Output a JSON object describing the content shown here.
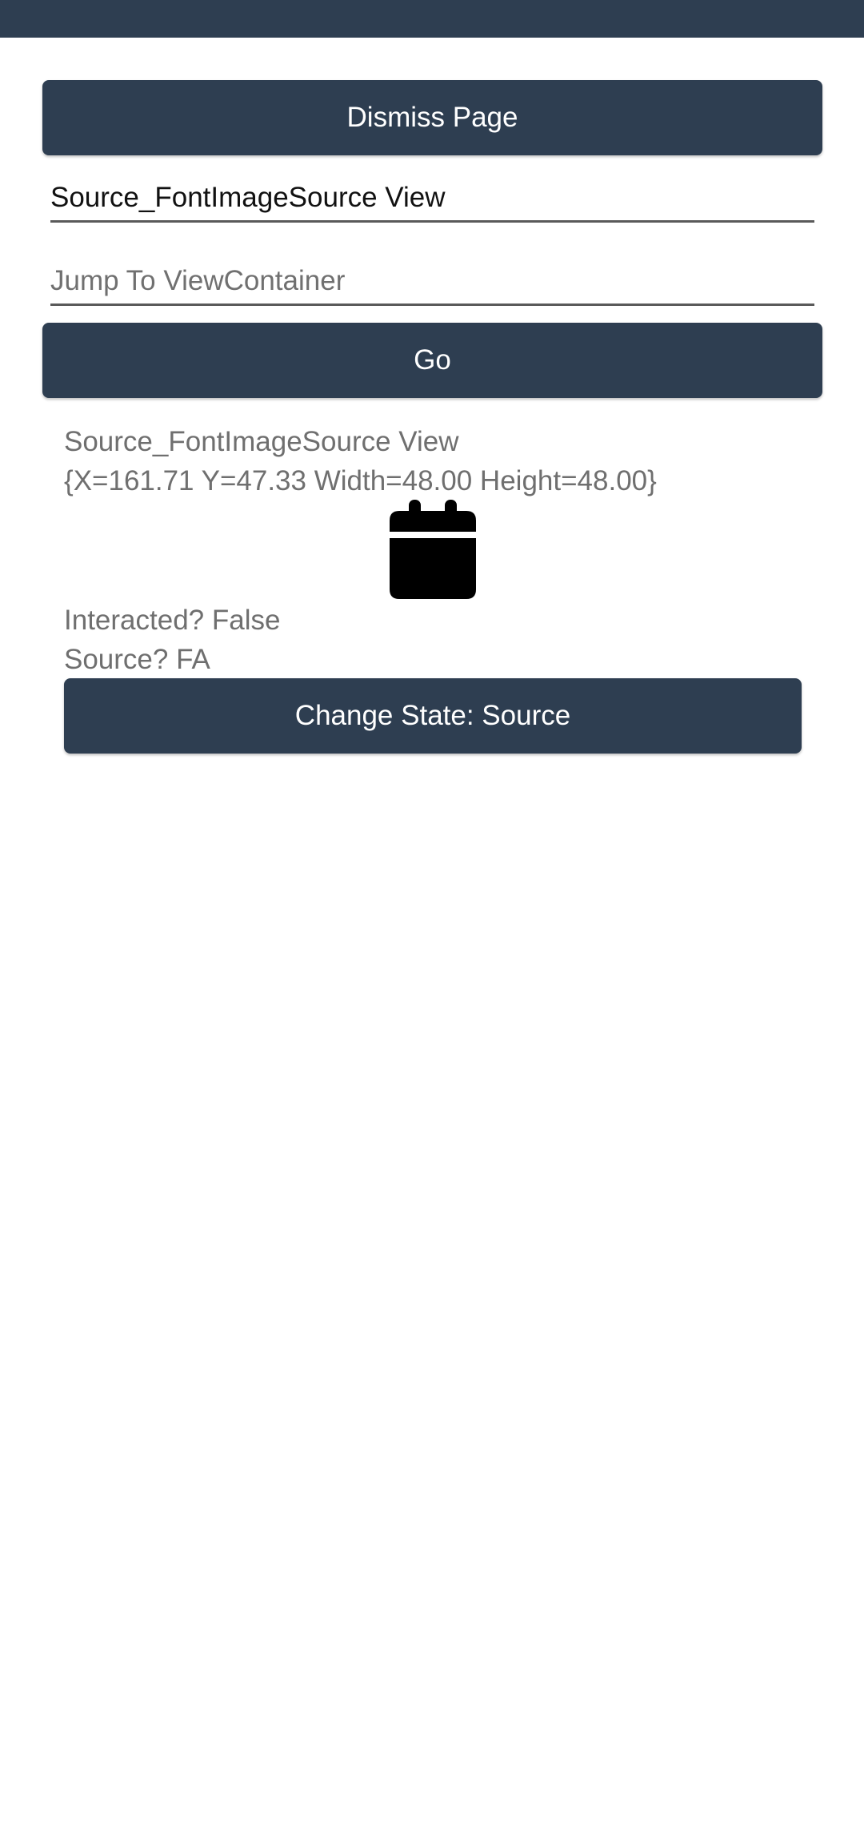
{
  "status_bar": {
    "color": "#2e3e51"
  },
  "header": {
    "dismiss_label": "Dismiss Page"
  },
  "form": {
    "source_view_value": "Source_FontImageSource View",
    "jump_placeholder": "Jump To ViewContainer",
    "go_label": "Go"
  },
  "view_container": {
    "view_name": "Source_FontImageSource View",
    "bounds": "{X=161.71 Y=47.33 Width=48.00 Height=48.00}",
    "icon": "calendar-icon",
    "interacted": "Interacted? False",
    "source": "Source? FA",
    "change_state_label": "Change State: Source"
  },
  "colors": {
    "accent": "#2e3e51",
    "label_text": "#6f6f6f"
  }
}
